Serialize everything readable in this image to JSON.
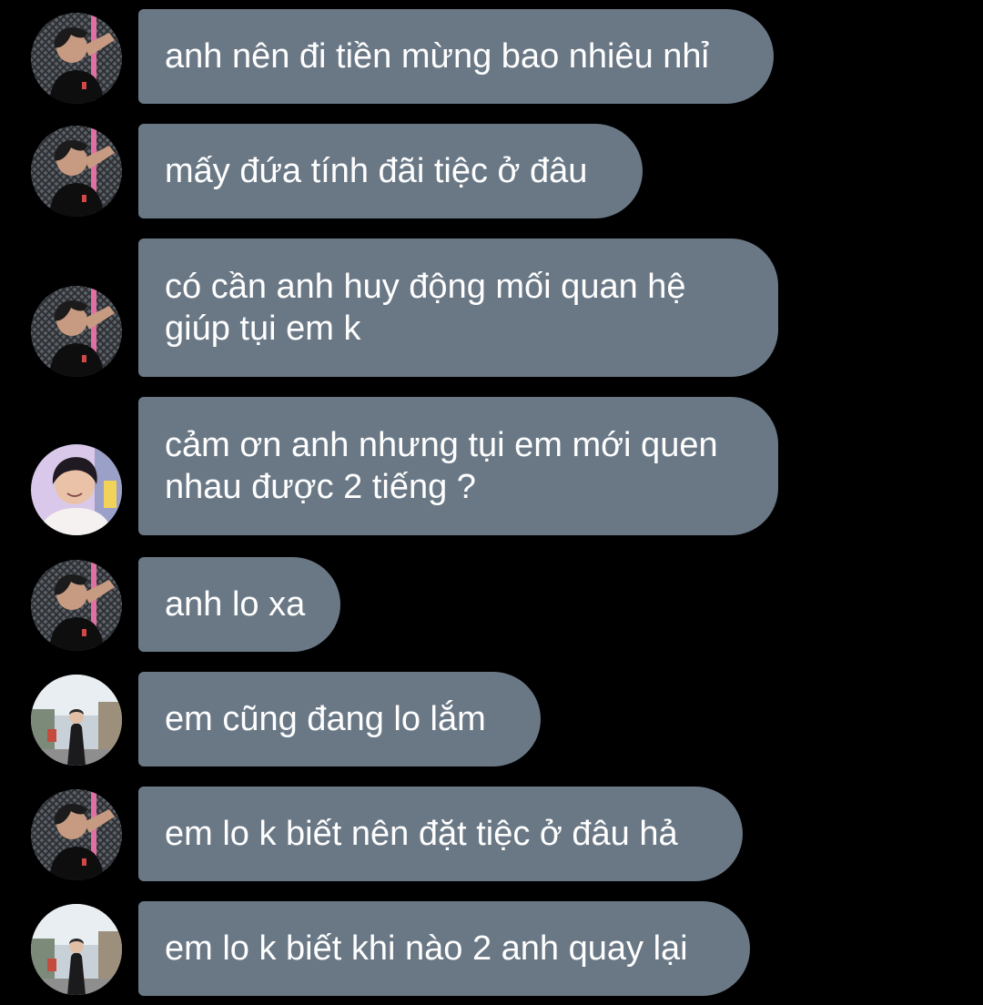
{
  "conversation": {
    "messages": [
      {
        "sender": "dark-shirt-user",
        "text": "anh nên đi tiền mừng bao nhiêu nhỉ"
      },
      {
        "sender": "dark-shirt-user",
        "text": "mấy đứa tính đãi tiệc ở đâu"
      },
      {
        "sender": "dark-shirt-user",
        "text": "có cần anh huy động mối quan hệ\ngiúp tụi em k"
      },
      {
        "sender": "smiling-user",
        "text": "cảm ơn anh nhưng tụi em mới quen\nnhau được 2 tiếng ?"
      },
      {
        "sender": "dark-shirt-user",
        "text": "anh lo xa"
      },
      {
        "sender": "street-user",
        "text": "em cũng đang lo lắm"
      },
      {
        "sender": "dark-shirt-user",
        "text": "em lo k biết nên đặt tiệc ở đâu hả"
      },
      {
        "sender": "street-user",
        "text": "em lo k biết khi nào 2 anh quay lại"
      }
    ]
  },
  "colors": {
    "background": "#000000",
    "bubble": "#6a7886",
    "text": "#ffffff"
  }
}
